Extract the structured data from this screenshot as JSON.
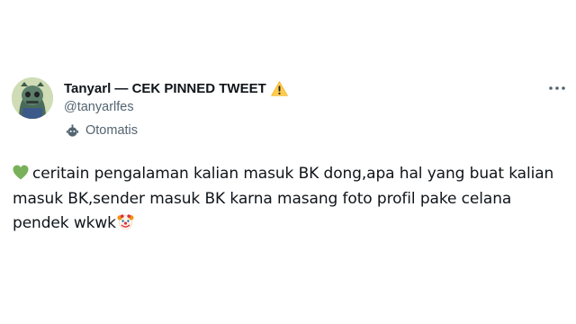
{
  "tweet": {
    "author_name": "Tanyarl — CEK PINNED TWEET",
    "handle": "@tanyarlfes",
    "automated_label": "Otomatis",
    "text_part_1": "ceritain pengalaman kalian masuk BK dong,apa hal yang buat kalian masuk BK,sender masuk BK karna masang foto profil pake celana pendek wkwk",
    "icons": {
      "name_badge": "warning-icon",
      "automated": "bot-icon",
      "menu": "more-icon",
      "text_leading": "green-heart-icon",
      "text_trailing": "clown-face-icon"
    },
    "colors": {
      "text_primary": "#0f1419",
      "text_secondary": "#536471",
      "heart": "#78b159",
      "warning": "#ffcc4d"
    }
  }
}
